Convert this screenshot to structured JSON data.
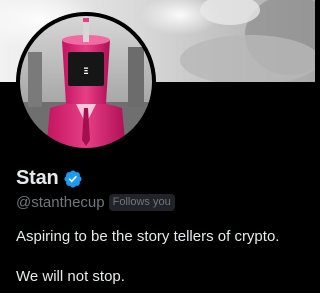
{
  "profile": {
    "display_name": "Stan",
    "handle": "@stanthecup",
    "follows_you": "Follows you",
    "bio_lines": [
      "Aspiring to be the story tellers of crypto.",
      "We will not stop."
    ]
  },
  "colors": {
    "background": "#000000",
    "primary_text": "#e7e9ea",
    "secondary_text": "#71767b",
    "verified_blue": "#1d9bf0",
    "badge_background": "#202327"
  },
  "icons": {
    "verified": "verified-badge-icon"
  }
}
